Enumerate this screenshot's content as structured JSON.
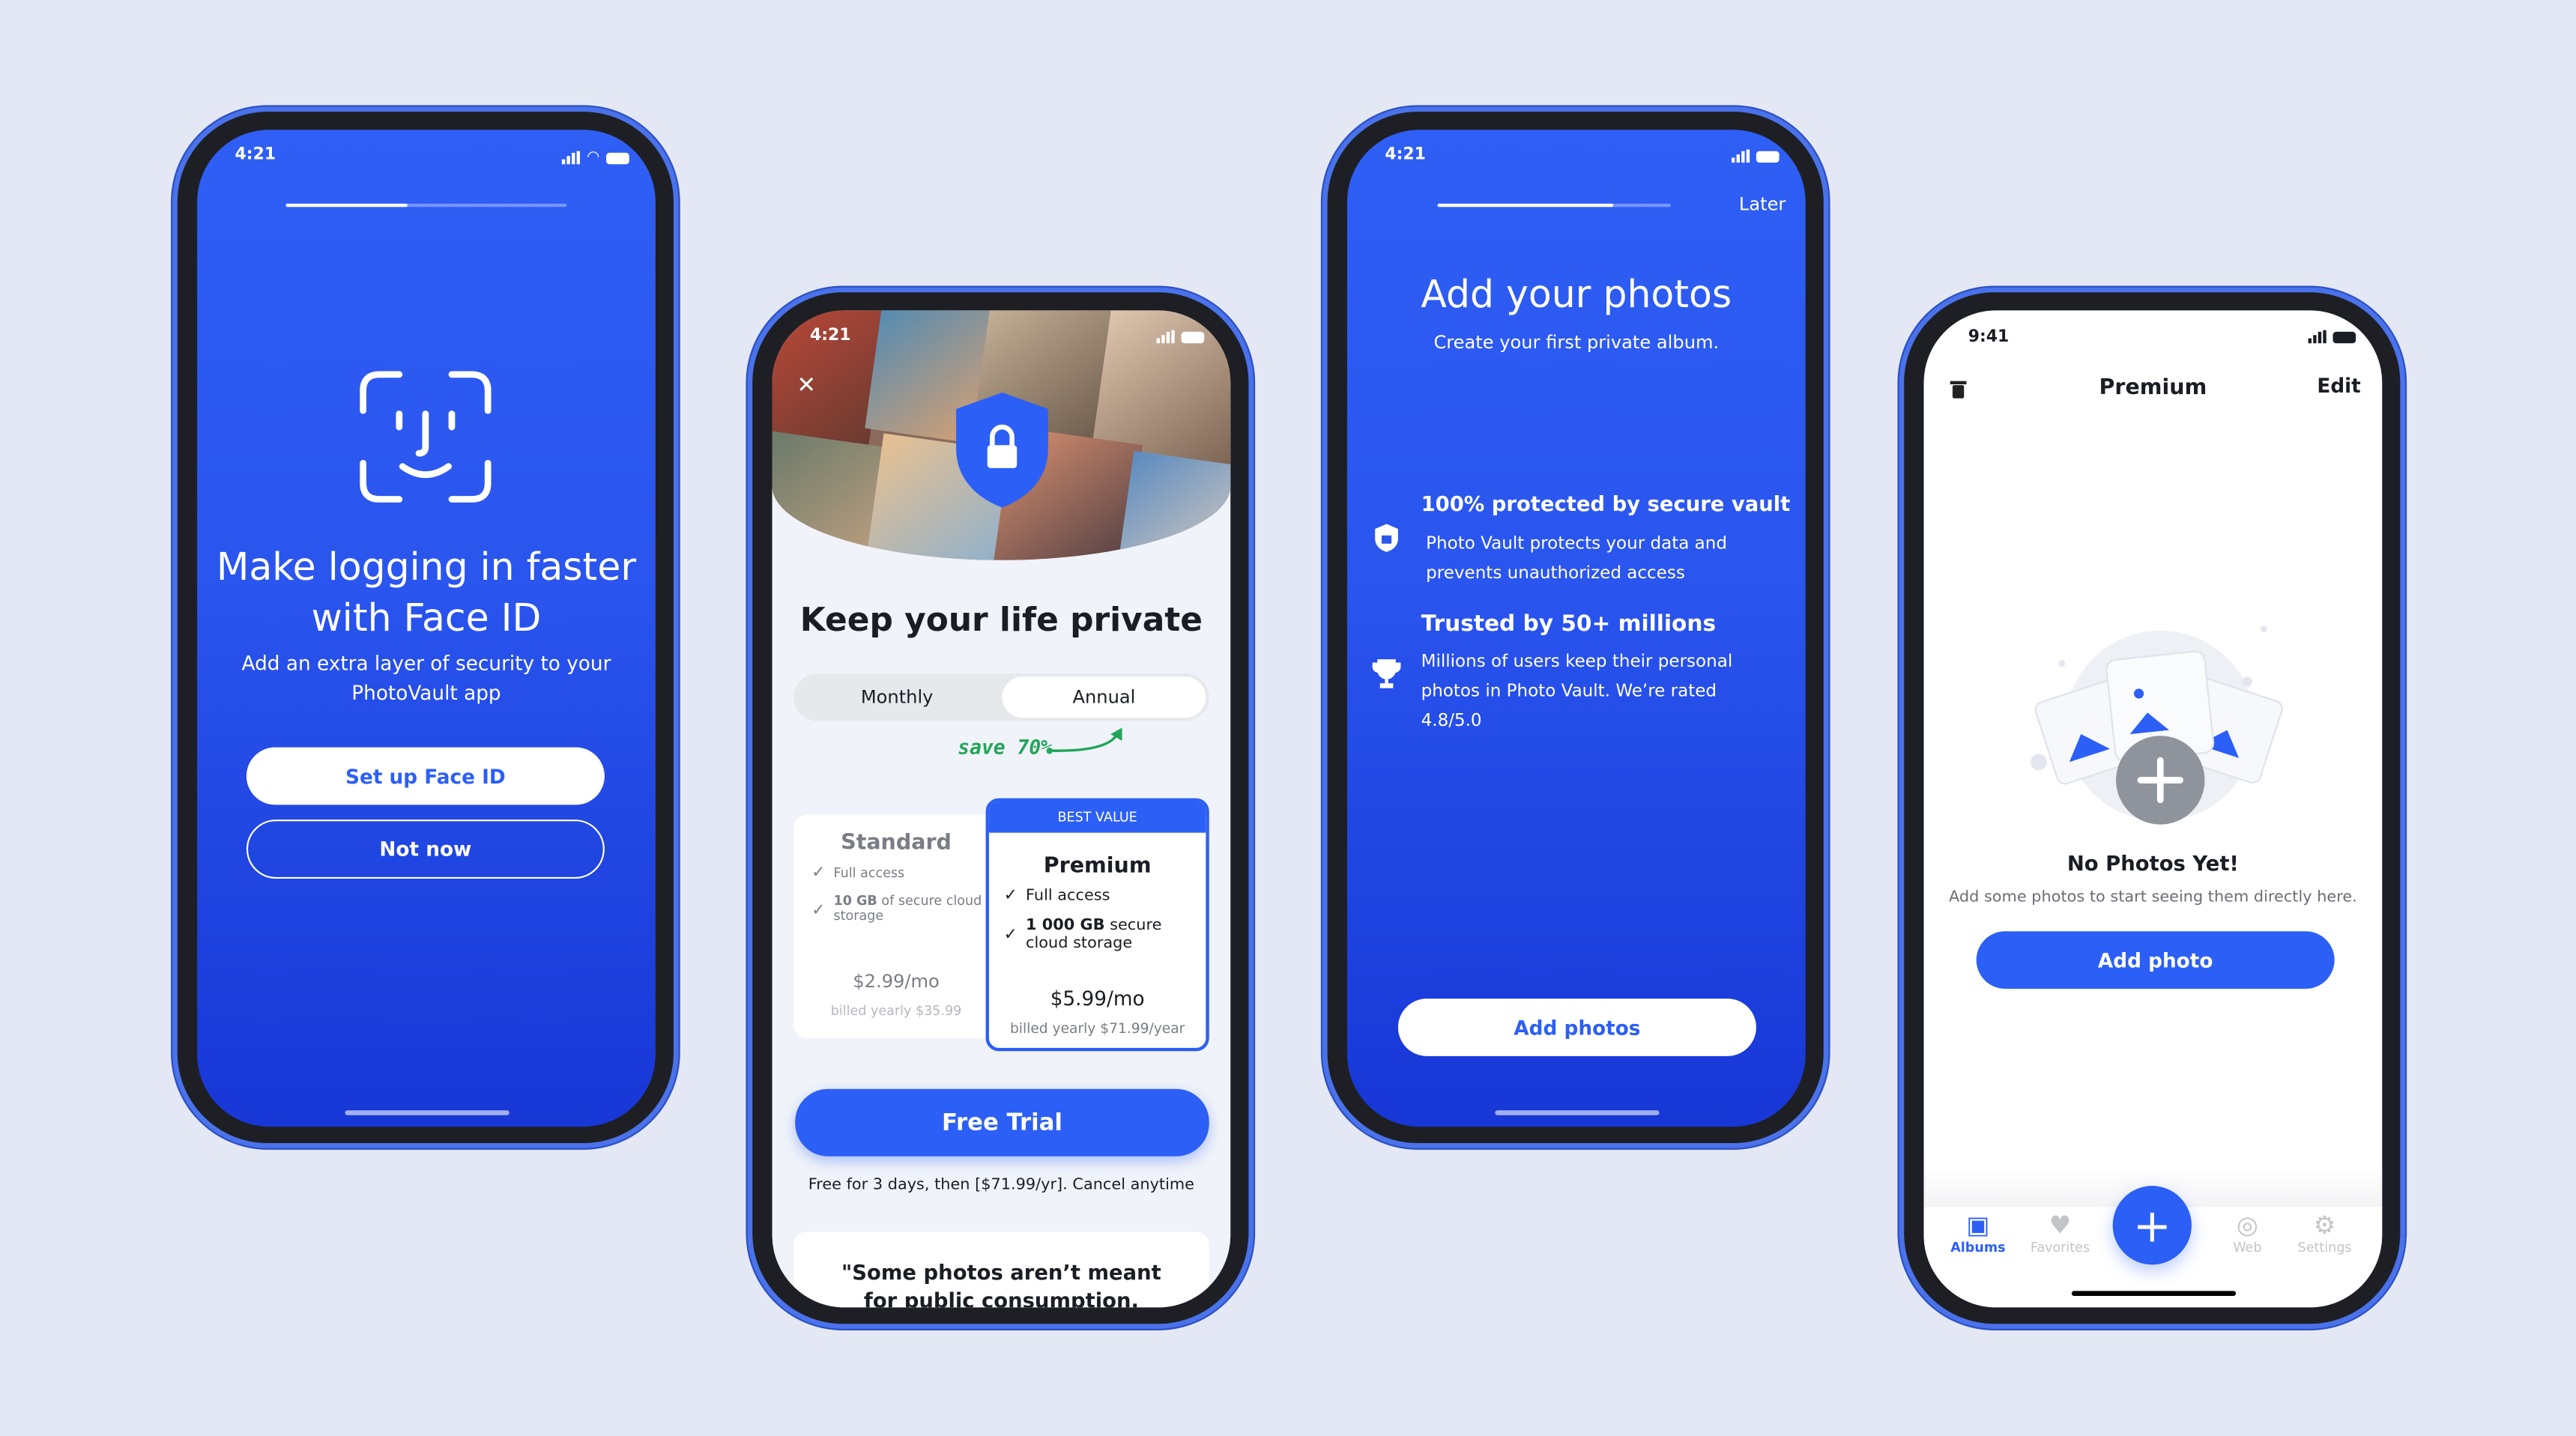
{
  "colors": {
    "accent": "#2c5ff6",
    "background": "#e4e8f4",
    "save_green": "#22a559"
  },
  "screen1": {
    "time": "4:21",
    "progress": 0.43,
    "icon": "face-id-icon",
    "title_line1": "Make logging in faster",
    "title_line2": "with Face ID",
    "subtitle_line1": "Add an extra layer of security to your",
    "subtitle_line2": "PhotoVault app",
    "primary_button": "Set up Face ID",
    "secondary_button": "Not now"
  },
  "screen2": {
    "time": "4:21",
    "close_icon": "close-icon",
    "lock_icon": "shield-lock-icon",
    "title": "Keep your life private",
    "toggle": {
      "options": [
        "Monthly",
        "Annual"
      ],
      "selected": "Annual"
    },
    "save_note": "save 70%",
    "plans": [
      {
        "name": "Standard",
        "features": [
          "Full access",
          "10 GB of secure cloud storage"
        ],
        "feature_bold": [
          "",
          "10 GB"
        ],
        "feature_rest": [
          "Full access",
          "of secure cloud storage"
        ],
        "price": "$2.99/mo",
        "billed": "billed yearly $35.99"
      },
      {
        "badge": "BEST VALUE",
        "name": "Premium",
        "features": [
          "Full access",
          "1 000 GB secure cloud storage"
        ],
        "feature_bold": [
          "",
          "1 000 GB"
        ],
        "feature_rest": [
          "Full access",
          "secure cloud storage"
        ],
        "price": "$5.99/mo",
        "billed": "billed yearly $71.99/year"
      }
    ],
    "cta": "Free Trial",
    "cta_note": "Free for 3 days, then [$71.99/yr]. Cancel anytime",
    "quote": "\"Some photos aren’t meant for public consumption. Here’s where"
  },
  "screen3": {
    "time": "4:21",
    "progress": 0.75,
    "later": "Later",
    "title": "Add your photos",
    "subtitle": "Create your first private album.",
    "features": [
      {
        "icon": "shield-lock-icon",
        "title": "100% protected by secure vault",
        "desc": "Photo Vault protects your data and prevents unauthorized access"
      },
      {
        "icon": "trophy-icon",
        "title": "Trusted by 50+ millions",
        "desc": "Millions of users keep their personal photos in Photo Vault. We’re rated 4.8/5.0"
      }
    ],
    "button": "Add photos"
  },
  "screen4": {
    "time": "9:41",
    "title": "Premium",
    "edit": "Edit",
    "empty_title": "No Photos Yet!",
    "empty_desc": "Add some photos to start seeing them directly here.",
    "button": "Add photo",
    "tabs": [
      {
        "label": "Albums",
        "icon": "albums-icon",
        "active": true
      },
      {
        "label": "Favorites",
        "icon": "heart-icon"
      },
      {
        "label": "Web",
        "icon": "globe-icon"
      },
      {
        "label": "Settings",
        "icon": "gear-icon"
      }
    ]
  }
}
